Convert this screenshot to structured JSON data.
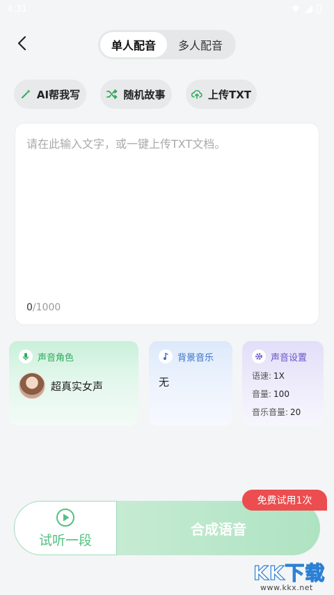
{
  "status_bar": {
    "time": "4:31"
  },
  "mode_tabs": [
    {
      "label": "单人配音",
      "active": true
    },
    {
      "label": "多人配音",
      "active": false
    }
  ],
  "actions": {
    "ai_write": "AI帮我写",
    "random_story": "随机故事",
    "upload_txt": "上传TXT"
  },
  "editor": {
    "placeholder": "请在此输入文字，或一键上传TXT文档。",
    "value": "",
    "count_current": "0",
    "count_max": "/1000"
  },
  "voice_card": {
    "title": "声音角色",
    "voice_name": "超真实女声"
  },
  "music_card": {
    "title": "背景音乐",
    "value": "无"
  },
  "settings_card": {
    "title": "声音设置",
    "items": [
      {
        "label": "语速:",
        "value": "1X"
      },
      {
        "label": "音量:",
        "value": "100"
      },
      {
        "label": "音乐音量:",
        "value": "20"
      }
    ]
  },
  "bottom": {
    "preview_label": "试听一段",
    "synthesize_label": "合成语音",
    "trial_badge": "免费试用1次"
  },
  "watermark": {
    "text": "KK下载",
    "url": "www.kkx.net"
  },
  "colors": {
    "accent_green": "#53c081",
    "badge_red": "#ec4d4f",
    "background": "#f4f5f6"
  }
}
